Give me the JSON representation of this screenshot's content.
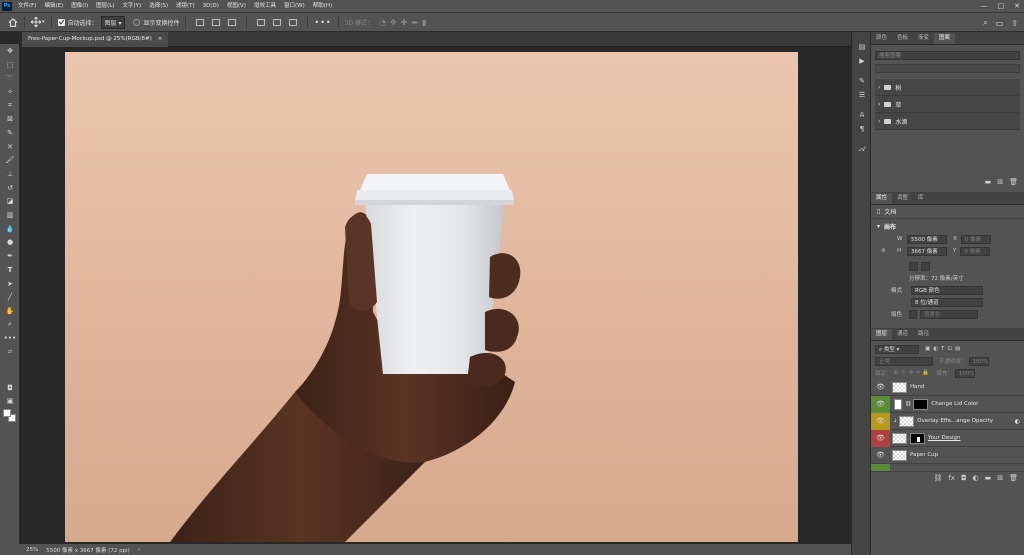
{
  "menu": [
    "文件(F)",
    "编辑(E)",
    "图像(I)",
    "图层(L)",
    "文字(Y)",
    "选择(S)",
    "滤镜(T)",
    "3D(D)",
    "视图(V)",
    "增效工具",
    "窗口(W)",
    "帮助(H)"
  ],
  "app_logo": "Ps",
  "window_controls": {
    "minimize": "—",
    "maximize": "□",
    "close": "✕"
  },
  "options": {
    "auto_select_label": "自动选择：",
    "auto_select_value": "图层",
    "show_transform_label": "显示变换控件",
    "mode_3d_label": "3D 模式："
  },
  "document_tab": {
    "title": "Free-Paper-Cup-Mockup.psd @ 25%(RGB/8#)",
    "close": "×"
  },
  "status": {
    "zoom": "25%",
    "doc_info": "5500 像素 x 3667 像素 (72 ppi)",
    "arrow": "›"
  },
  "library_panel": {
    "tabs": [
      "颜色",
      "色板",
      "渐变",
      "图案"
    ],
    "active_tab": 3,
    "search_placeholder": "搜索图案",
    "groups": [
      "树",
      "草",
      "水滴"
    ]
  },
  "properties_panel": {
    "tabs": [
      "属性",
      "调整",
      "库"
    ],
    "active_tab": 0,
    "doc_label": "文档",
    "canvas_label": "画布",
    "w_label": "W",
    "w_value": "5500 像素",
    "x_label": "X",
    "x_value": "0 像素",
    "h_label": "H",
    "h_value": "3667 像素",
    "y_label": "Y",
    "y_value": "0 像素",
    "resolution": "分辨率：72 像素/英寸",
    "mode_label": "模式",
    "mode_value": "RGB 颜色",
    "depth_value": "8 位/通道",
    "fill_label": "填色",
    "fill_value": "背景色"
  },
  "layers_panel": {
    "tabs": [
      "图层",
      "通道",
      "路径"
    ],
    "active_tab": 0,
    "filter_label": "类型",
    "blend_mode": "正常",
    "opacity_label": "不透明度：",
    "opacity_value": "100%",
    "lock_label": "锁定：",
    "fill_label": "填充：",
    "fill_value": "100%",
    "layers": [
      {
        "name": "Hand",
        "color": "",
        "visible": true
      },
      {
        "name": "Change Lid Color",
        "color": "#5a8c3a",
        "visible": true
      },
      {
        "name": "Overlay Effe...ange Opacity",
        "color": "#b89a1a",
        "visible": true
      },
      {
        "name": "Your Design",
        "color": "#b04040",
        "visible": true
      },
      {
        "name": "Paper Cup",
        "color": "",
        "visible": true
      },
      {
        "name": "",
        "color": "#5a8c3a",
        "visible": true
      }
    ]
  },
  "colors": {
    "accent": "#31a8ff",
    "panel": "#535353",
    "workspace": "#282828",
    "canvas_bg": "#e2b9a0"
  }
}
